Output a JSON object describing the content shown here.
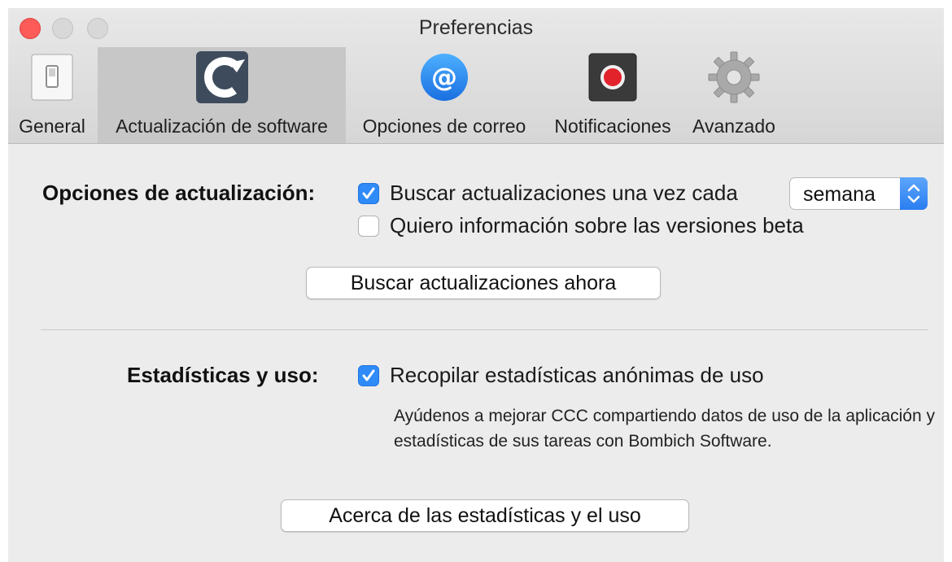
{
  "window": {
    "title": "Preferencias"
  },
  "tabs": [
    {
      "label": "General",
      "icon": "toggle-switch-icon",
      "selected": false
    },
    {
      "label": "Actualización de software",
      "icon": "ccc-logo-icon",
      "selected": true
    },
    {
      "label": "Opciones de correo",
      "icon": "at-sign-icon",
      "selected": false
    },
    {
      "label": "Notificaciones",
      "icon": "record-icon",
      "selected": false
    },
    {
      "label": "Avanzado",
      "icon": "gear-icon",
      "selected": false
    }
  ],
  "update": {
    "section_label": "Opciones de actualización:",
    "check_label": "Buscar actualizaciones una vez cada",
    "check_checked": true,
    "frequency": "semana",
    "beta_label": "Quiero información sobre las versiones beta",
    "beta_checked": false,
    "check_now_button": "Buscar actualizaciones ahora"
  },
  "stats": {
    "section_label": "Estadísticas y uso:",
    "collect_label": "Recopilar estadísticas anónimas de uso",
    "collect_checked": true,
    "description": "Ayúdenos a mejorar CCC compartiendo datos de uso de la aplicación y estadísticas de sus tareas con Bombich Software.",
    "about_button": "Acerca de las estadísticas y el uso"
  },
  "colors": {
    "accent": "#2f8bf7",
    "close": "#fc5b57",
    "selected_tab": "#c7c7c7",
    "window_bg": "#ececec"
  }
}
